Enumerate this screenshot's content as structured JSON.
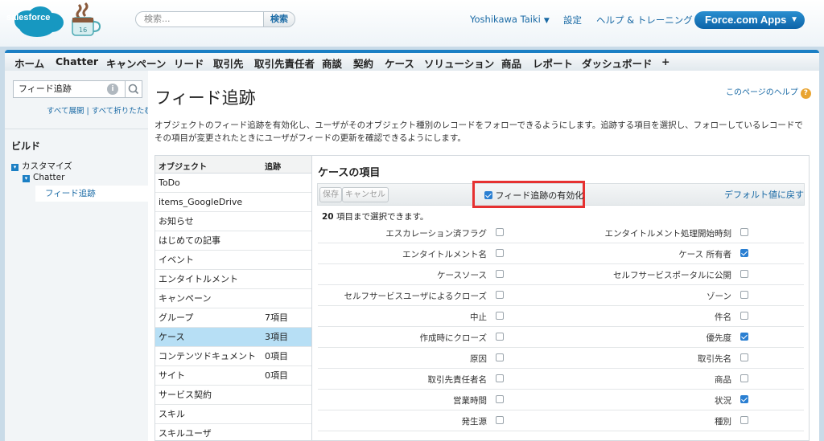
{
  "header": {
    "logo_text": "salesforce",
    "mug_number": "16",
    "search_placeholder": "検索...",
    "search_button": "検索",
    "user_name": "Yoshikawa Taiki",
    "settings": "設定",
    "help_training": "ヘルプ & トレーニング",
    "app_menu": "Force.com Apps"
  },
  "nav": [
    "ホーム",
    "Chatter",
    "キャンペーン",
    "リード",
    "取引先",
    "取引先責任者",
    "商談",
    "契約",
    "ケース",
    "ソリューション",
    "商品",
    "レポート",
    "ダッシュボード",
    "+"
  ],
  "sidebar": {
    "search_value": "フィード追跡",
    "expand_all": "すべて展開",
    "separator": "|",
    "collapse_all": "すべて折りたたむ",
    "build_heading": "ビルド",
    "tree": {
      "customize": "カスタマイズ",
      "chatter": "Chatter",
      "feed_tracking": "フィード追跡"
    }
  },
  "main": {
    "title": "フィード追跡",
    "help_link": "このページのヘルプ",
    "description": "オブジェクトのフィード追跡を有効化し、ユーザがそのオブジェクト種別のレコードをフォローできるようにします。追跡する項目を選択し、フォローしているレコードでその項目が変更されたときにユーザがフィードの更新を確認できるようにします。",
    "objects": {
      "col_object": "オブジェクト",
      "col_tracking": "追跡",
      "rows": [
        {
          "name": "ToDo",
          "tracking": ""
        },
        {
          "name": "items_GoogleDrive",
          "tracking": ""
        },
        {
          "name": "お知らせ",
          "tracking": ""
        },
        {
          "name": "はじめての記事",
          "tracking": ""
        },
        {
          "name": "イベント",
          "tracking": ""
        },
        {
          "name": "エンタイトルメント",
          "tracking": ""
        },
        {
          "name": "キャンペーン",
          "tracking": ""
        },
        {
          "name": "グループ",
          "tracking": "7項目"
        },
        {
          "name": "ケース",
          "tracking": "3項目",
          "selected": true
        },
        {
          "name": "コンテンツドキュメント",
          "tracking": "0項目"
        },
        {
          "name": "サイト",
          "tracking": "0項目"
        },
        {
          "name": "サービス契約",
          "tracking": ""
        },
        {
          "name": "スキル",
          "tracking": ""
        },
        {
          "name": "スキルユーザ",
          "tracking": ""
        }
      ]
    },
    "fields_panel": {
      "title": "ケースの項目",
      "save": "保存",
      "cancel": "キャンセル",
      "enable_feed_tracking": "フィード追跡の有効化",
      "enable_checked": true,
      "restore_defaults": "デフォルト値に戻す",
      "limit_count": "20",
      "limit_text": " 項目まで選択できます。",
      "rows": [
        {
          "left": "エスカレーション済フラグ",
          "left_checked": false,
          "right": "エンタイトルメント処理開始時刻",
          "right_checked": false
        },
        {
          "left": "エンタイトルメント名",
          "left_checked": false,
          "right": "ケース 所有者",
          "right_checked": true
        },
        {
          "left": "ケースソース",
          "left_checked": false,
          "right": "セルフサービスポータルに公開",
          "right_checked": false
        },
        {
          "left": "セルフサービスユーザによるクローズ",
          "left_checked": false,
          "right": "ゾーン",
          "right_checked": false
        },
        {
          "left": "中止",
          "left_checked": false,
          "right": "件名",
          "right_checked": false
        },
        {
          "left": "作成時にクローズ",
          "left_checked": false,
          "right": "優先度",
          "right_checked": true
        },
        {
          "left": "原因",
          "left_checked": false,
          "right": "取引先名",
          "right_checked": false
        },
        {
          "left": "取引先責任者名",
          "left_checked": false,
          "right": "商品",
          "right_checked": false
        },
        {
          "left": "営業時間",
          "left_checked": false,
          "right": "状況",
          "right_checked": true
        },
        {
          "left": "発生源",
          "left_checked": false,
          "right": "種別",
          "right_checked": false
        }
      ]
    }
  },
  "colors": {
    "accent_blue": "#1b7fc4",
    "link_blue": "#1a6aa5",
    "selected_row": "#b7dff5",
    "highlight_red": "#e63131"
  }
}
